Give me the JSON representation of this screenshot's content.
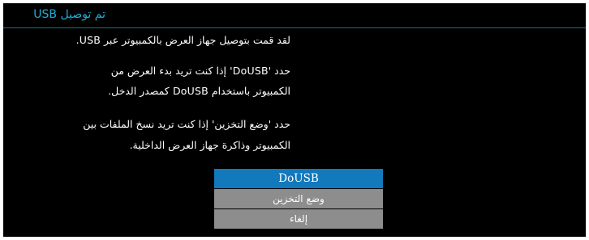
{
  "dialog": {
    "title": "تم توصيل USB",
    "lines": [
      "لقد قمت بتوصيل جهاز العرض بالكمبيوتر عبر USB.",
      "حدد 'DoUSB' إذا كنت تريد بدء العرض من",
      "الكمبيوتر باستخدام DoUSB كمصدر الدخل.",
      "حدد 'وضع التخزين' إذا كنت تريد نسخ الملفات بين",
      "الكمبيوتر وذاكرة جهاز العرض الداخلية."
    ],
    "options": [
      {
        "label": "DoUSB",
        "selected": true
      },
      {
        "label": "وضع التخزين",
        "selected": false
      },
      {
        "label": "إلغاء",
        "selected": false
      }
    ],
    "colors": {
      "background": "#000000",
      "title": "#1bb0d8",
      "selected": "#1279bd",
      "option": "#8d8d8d"
    }
  }
}
